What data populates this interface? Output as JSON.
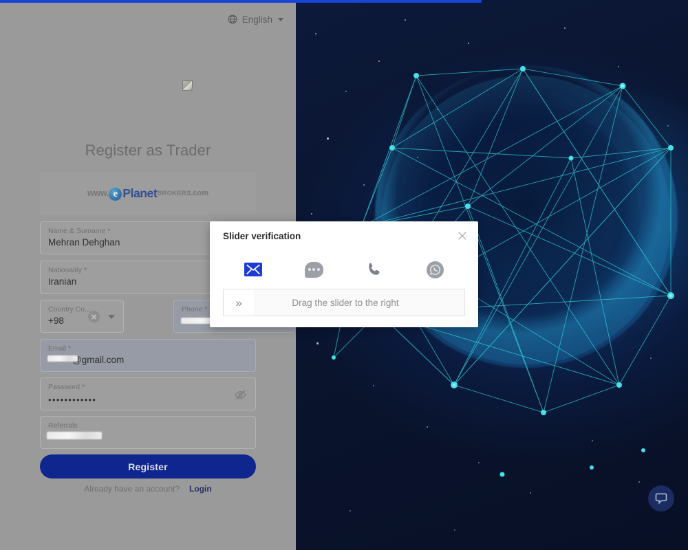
{
  "page": {
    "title": "Register as Trader",
    "progress_percent": 70,
    "accent_color": "#10268f",
    "overlay_color": "#9a9a9a"
  },
  "topbar": {
    "language_label": "English",
    "globe_icon": "globe-icon",
    "caret_icon": "chevron-down-icon"
  },
  "brand": {
    "logo_placeholder_icon": "broken-image-icon",
    "www": "www.",
    "e_mark": "e",
    "planet": "Planet",
    "brokers": "BROKERS",
    "dotcom": ".com"
  },
  "form": {
    "fields": [
      {
        "label": "Name & Surname *",
        "value": "Mehran Dehghan"
      },
      {
        "label": "Nationality *",
        "value": "Iranian"
      },
      {
        "label": "Country Co...",
        "value": "+98"
      },
      {
        "label": "Phone *",
        "value": ""
      },
      {
        "label": "Email *",
        "value": "@gmail.com"
      },
      {
        "label": "Password *",
        "value": "••••••••••••"
      },
      {
        "label": "Referrals",
        "value": ""
      }
    ],
    "clear_icon": "clear-circle-icon",
    "dropdown_icon": "chevron-down-icon",
    "password_toggle_icon": "eye-off-icon",
    "submit_label": "Register",
    "have_account_text": "Already have an account?",
    "login_label": "Login"
  },
  "modal": {
    "title": "Slider verification",
    "close_icon": "close-icon",
    "channels": [
      {
        "name": "email-channel",
        "icon": "envelope-icon",
        "selected": true
      },
      {
        "name": "sms-channel",
        "icon": "chat-bubble-icon",
        "selected": false
      },
      {
        "name": "call-channel",
        "icon": "phone-icon",
        "selected": false
      },
      {
        "name": "whatsapp-channel",
        "icon": "whatsapp-icon",
        "selected": false
      }
    ],
    "slider": {
      "handle_icon": "double-chevron-right-icon",
      "handle_glyph": "»",
      "instruction": "Drag the slider to the right"
    }
  },
  "chat": {
    "icon": "chat-widget-icon",
    "label": ""
  }
}
